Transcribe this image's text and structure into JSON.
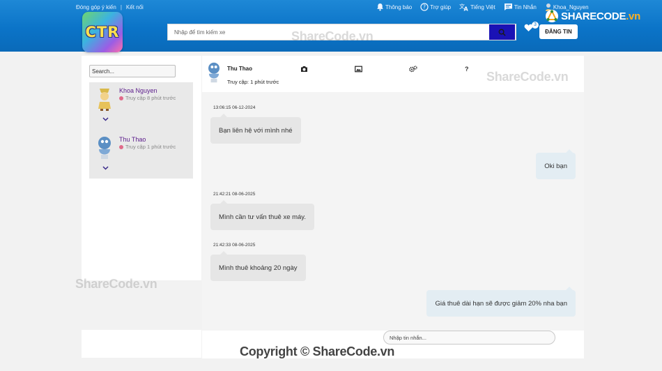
{
  "header": {
    "top_links": [
      "Đóng góp ý kiến",
      "Kết nối"
    ],
    "top_sep": "|",
    "logo_text": "CTR",
    "search_placeholder": "Nhập để tìm kiếm xe",
    "nav": [
      {
        "label": "Thông báo",
        "icon": "bell-icon"
      },
      {
        "label": "Trợ giúp",
        "icon": "help-icon"
      },
      {
        "label": "Tiếng Việt",
        "icon": "translate-icon"
      },
      {
        "label": "Tin Nhắn",
        "icon": "message-icon"
      },
      {
        "label": "Khoa_Nguyen",
        "icon": "user-avatar-icon"
      }
    ],
    "favorites_count": "3",
    "post_button": "ĐĂNG TIN",
    "brand_logo": "SHARECODE",
    "brand_logo_suffix": ".vn"
  },
  "sidebar": {
    "search_placeholder": "Search...",
    "users": [
      {
        "name": "Khoa Nguyen",
        "status": "Truy cập 8 phút trước"
      },
      {
        "name": "Thu Thao",
        "status": "Truy cập 1 phút trước"
      }
    ]
  },
  "chat": {
    "contact_name": "Thu Thao",
    "contact_status": "Truy cập: 1 phút trước",
    "header_icons": [
      "camera-icon",
      "image-icon",
      "settings-icon",
      "help-icon"
    ],
    "help_symbol": "?",
    "messages": [
      {
        "side": "left",
        "timestamp": "13:06:15 06-12-2024",
        "text": "Bạn liên hệ với mình nhé"
      },
      {
        "side": "right",
        "timestamp": "",
        "text": "Oki bạn"
      },
      {
        "side": "left",
        "timestamp": "21:42:21 08-06-2025",
        "text": "Mình cần tư vấn thuê xe máy."
      },
      {
        "side": "left",
        "timestamp": "21:42:33 08-06-2025",
        "text": "Mình thuê khoảng 20 ngày"
      },
      {
        "side": "right",
        "timestamp": "",
        "text": "Giá thuê dài hạn sẽ được giảm 20% nha bạn"
      }
    ],
    "input_placeholder": "Nhập tin nhắn..."
  },
  "watermarks": [
    "ShareCode.vn",
    "ShareCode.vn",
    "ShareCode.vn"
  ],
  "copyright": "Copyright © ShareCode.vn"
}
